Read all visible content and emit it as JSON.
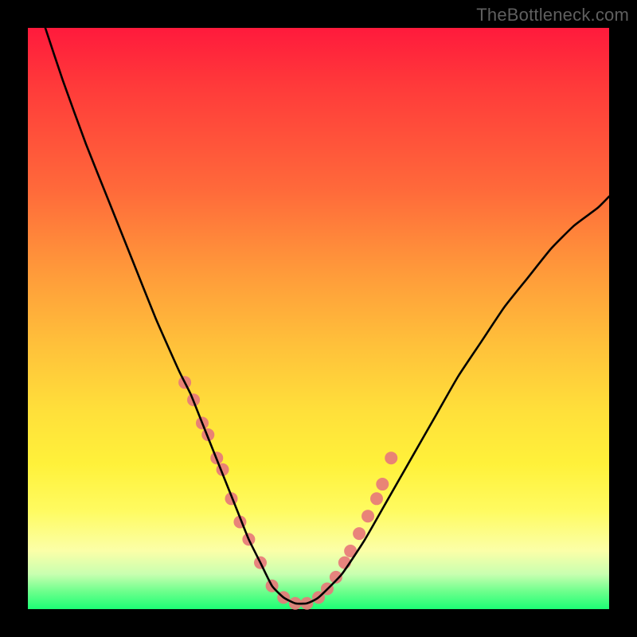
{
  "watermark": "TheBottleneck.com",
  "chart_data": {
    "type": "line",
    "title": "",
    "xlabel": "",
    "ylabel": "",
    "xlim": [
      0,
      100
    ],
    "ylim": [
      0,
      100
    ],
    "grid": false,
    "legend": false,
    "series": [
      {
        "name": "bottleneck-curve",
        "color": "#000000",
        "x": [
          3,
          6,
          10,
          14,
          18,
          22,
          26,
          28,
          30,
          32,
          34,
          36,
          38,
          40,
          42,
          44,
          46,
          48,
          50,
          54,
          58,
          62,
          66,
          70,
          74,
          78,
          82,
          86,
          90,
          94,
          98,
          100
        ],
        "y": [
          100,
          91,
          80,
          70,
          60,
          50,
          41,
          37,
          32,
          27,
          22,
          17,
          12,
          8,
          4,
          2,
          1,
          1,
          2,
          6,
          12,
          19,
          26,
          33,
          40,
          46,
          52,
          57,
          62,
          66,
          69,
          71
        ]
      }
    ],
    "scatter_markers": {
      "comment": "pink dot markers shown on the lower legs of the V curve",
      "color": "#e77a7a",
      "radius_px": 8,
      "points_x": [
        27,
        28.5,
        30,
        31,
        32.5,
        33.5,
        35,
        36.5,
        38,
        40,
        42,
        44,
        46,
        48,
        50,
        51.5,
        53,
        54.5,
        55.5,
        57,
        58.5,
        60,
        61,
        62.5
      ],
      "points_y": [
        39,
        36,
        32,
        30,
        26,
        24,
        19,
        15,
        12,
        8,
        4,
        2,
        1,
        1,
        2,
        3.5,
        5.5,
        8,
        10,
        13,
        16,
        19,
        21.5,
        26
      ]
    },
    "gradient_stops": [
      {
        "pos": 0,
        "color": "#ff1a3c"
      },
      {
        "pos": 10,
        "color": "#ff3a3a"
      },
      {
        "pos": 28,
        "color": "#ff6a3a"
      },
      {
        "pos": 42,
        "color": "#ff9a3a"
      },
      {
        "pos": 55,
        "color": "#ffc23a"
      },
      {
        "pos": 66,
        "color": "#ffe03a"
      },
      {
        "pos": 75,
        "color": "#fff13a"
      },
      {
        "pos": 83,
        "color": "#fffb60"
      },
      {
        "pos": 90,
        "color": "#fbffa8"
      },
      {
        "pos": 94,
        "color": "#c8ffb0"
      },
      {
        "pos": 97,
        "color": "#6cff8c"
      },
      {
        "pos": 100,
        "color": "#1cff74"
      }
    ]
  }
}
